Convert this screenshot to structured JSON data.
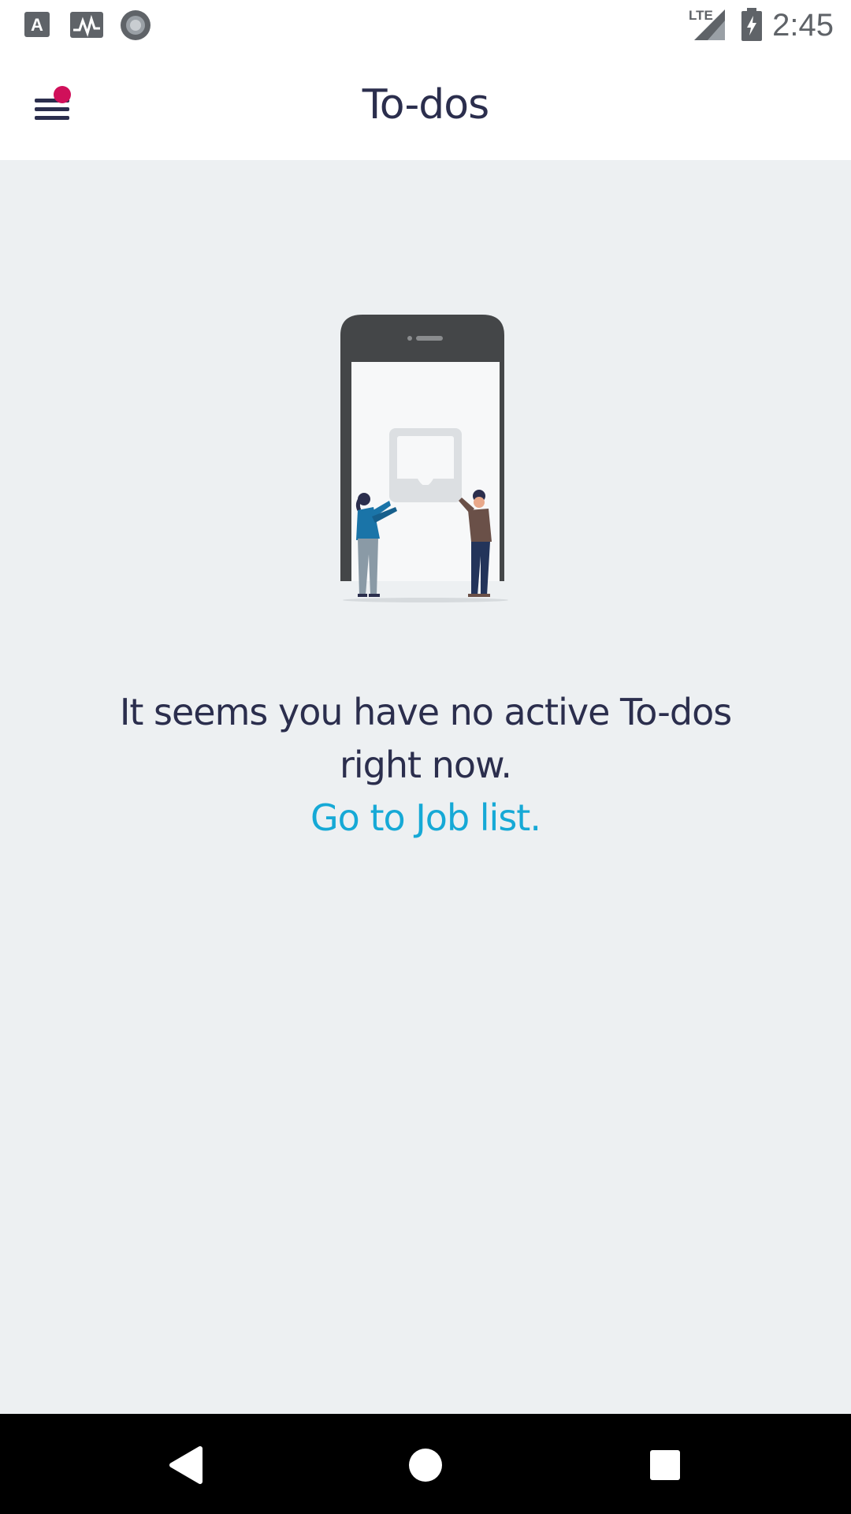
{
  "status_bar": {
    "time": "2:45",
    "network_label": "LTE",
    "left_icons": [
      "text-a-icon",
      "activity-icon",
      "record-icon"
    ],
    "right_icons": [
      "signal-icon",
      "battery-charging-icon"
    ]
  },
  "app_bar": {
    "title": "To-dos",
    "menu_icon": "hamburger-menu-icon",
    "notification_dot_color": "#d0105a"
  },
  "empty_state": {
    "message_line1": "It seems you have no active To-dos",
    "message_line2": "right now.",
    "link_label": "Go to Job list.",
    "link_color": "#16a9d6",
    "text_color": "#2b2e4d"
  },
  "nav_bar": {
    "buttons": [
      "back-icon",
      "home-icon",
      "recents-icon"
    ]
  }
}
